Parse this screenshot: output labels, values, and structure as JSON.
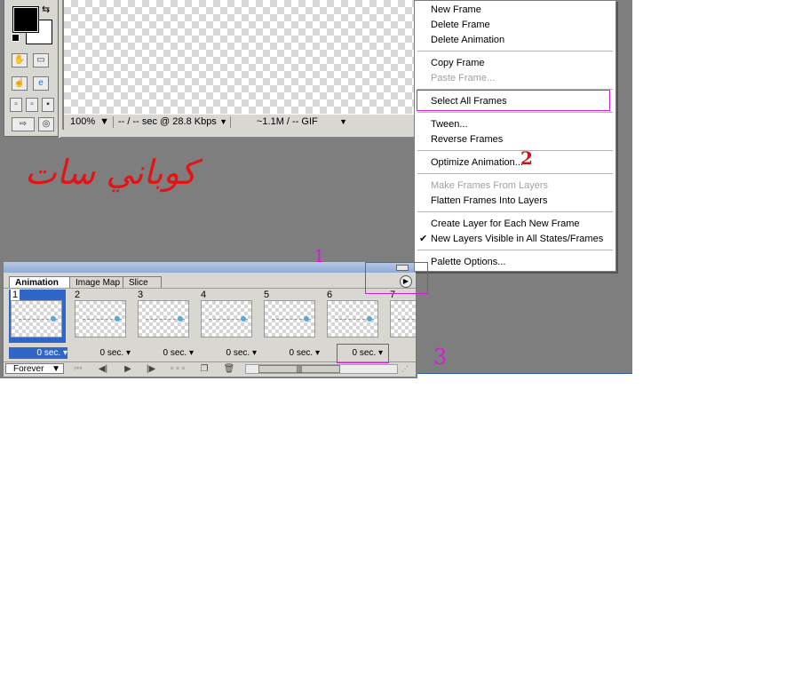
{
  "canvas_status": {
    "zoom": "100%",
    "download_time": "-- / -- sec @ 28.8 Kbps",
    "file_info": "~1.1M / -- GIF"
  },
  "signature_text": "كوباني سات",
  "palette": {
    "tabs": [
      "Animation",
      "Image Map",
      "Slice"
    ],
    "frames": [
      {
        "number": "1",
        "delay": "0 sec."
      },
      {
        "number": "2",
        "delay": "0 sec."
      },
      {
        "number": "3",
        "delay": "0 sec."
      },
      {
        "number": "4",
        "delay": "0 sec."
      },
      {
        "number": "5",
        "delay": "0 sec."
      },
      {
        "number": "6",
        "delay": "0 sec."
      },
      {
        "number": "7",
        "delay": ""
      }
    ],
    "loop_option": "Forever"
  },
  "menu": {
    "items": [
      {
        "label": "New Frame",
        "enabled": true
      },
      {
        "label": "Delete Frame",
        "enabled": true
      },
      {
        "label": "Delete Animation",
        "enabled": true
      },
      {
        "label": "Copy Frame",
        "enabled": true
      },
      {
        "label": "Paste Frame...",
        "enabled": false
      },
      {
        "label": "Select All Frames",
        "enabled": true
      },
      {
        "label": "Tween...",
        "enabled": true
      },
      {
        "label": "Reverse Frames",
        "enabled": true
      },
      {
        "label": "Optimize Animation...",
        "enabled": true
      },
      {
        "label": "Make Frames From Layers",
        "enabled": false
      },
      {
        "label": "Flatten Frames Into Layers",
        "enabled": true
      },
      {
        "label": "Create Layer for Each New Frame",
        "enabled": true
      },
      {
        "label": "New Layers Visible in All States/Frames",
        "enabled": true,
        "checked": true
      },
      {
        "label": "Palette Options...",
        "enabled": true
      }
    ]
  },
  "annotations": {
    "step1": "1",
    "step2": "2",
    "step3": "3"
  },
  "colors": {
    "workspace_bg": "#7e7e7e",
    "highlight": "#d61bd6",
    "selection": "#2f66c7",
    "signature": "#e21414"
  }
}
